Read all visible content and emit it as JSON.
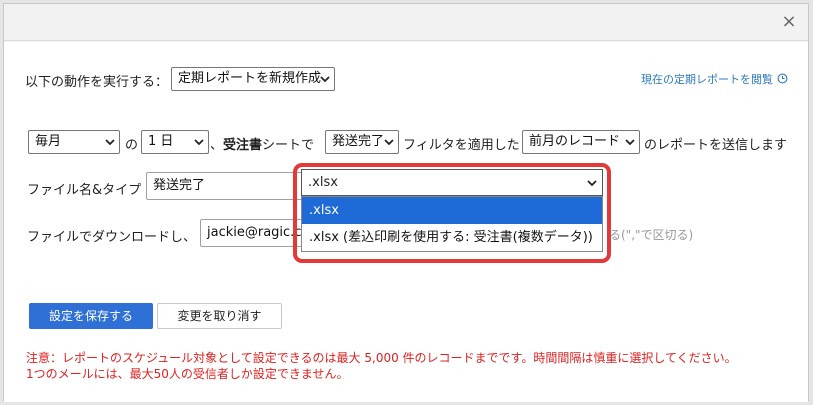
{
  "dialog": {
    "close_icon": "×"
  },
  "row0": {
    "label": "以下の動作を実行する：",
    "action_select": "定期レポートを新規作成",
    "view_link": "現在の定期レポートを閲覧"
  },
  "row1": {
    "frequency": "毎月",
    "sep_no": "の",
    "day": "1 日",
    "sheet_prefix": "、",
    "sheet_name": "受注書",
    "sheet_suffix": "シートで",
    "filter": "発送完了",
    "filter_label": "フィルタを適用した",
    "period": "前月のレコード",
    "send_label": "のレポートを送信します"
  },
  "row2": {
    "label": "ファイル名&タイプ",
    "file_name": "発送完了",
    "file_type": ".xlsx",
    "options": [
      ".xlsx",
      ".xlsx (差込印刷を使用する: 受注書(複数データ))"
    ]
  },
  "row3": {
    "label": "ファイルでダウンロードし、",
    "email": "jackie@ragic.co",
    "hint": "る(\",\"で区切る)"
  },
  "buttons": {
    "save": "設定を保存する",
    "cancel": "変更を取り消す"
  },
  "warnings": {
    "line1": "注意：レポートのスケジュール対象として設定できるのは最大 5,000 件のレコードまでです。時間間隔は慎重に選択してください。",
    "line2": "1つのメールには、最大50人の受信者しか設定できません。"
  },
  "colors": {
    "accent": "#2f70d6",
    "highlight": "#e53939",
    "link": "#2b79c2",
    "warning": "#e02020"
  }
}
